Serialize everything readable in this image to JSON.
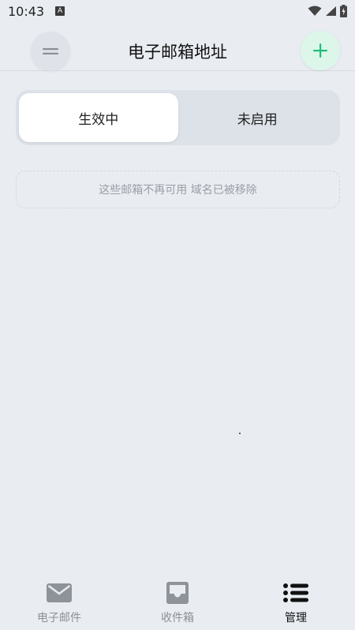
{
  "status_bar": {
    "time": "10:43",
    "notification_badge": "A"
  },
  "header": {
    "title": "电子邮箱地址"
  },
  "segments": [
    {
      "label": "生效中",
      "active": true
    },
    {
      "label": "未启用",
      "active": false
    }
  ],
  "notice": {
    "text": "这些邮箱不再可用 域名已被移除"
  },
  "bottom_nav": [
    {
      "label": "电子邮件",
      "icon": "mail-icon",
      "active": false
    },
    {
      "label": "收件箱",
      "icon": "inbox-icon",
      "active": false
    },
    {
      "label": "管理",
      "icon": "list-icon",
      "active": true
    }
  ],
  "colors": {
    "background": "#e9edf2",
    "accent": "#1fbf7a",
    "add_button_bg": "#dcf7ea",
    "inactive": "#8c9096"
  }
}
